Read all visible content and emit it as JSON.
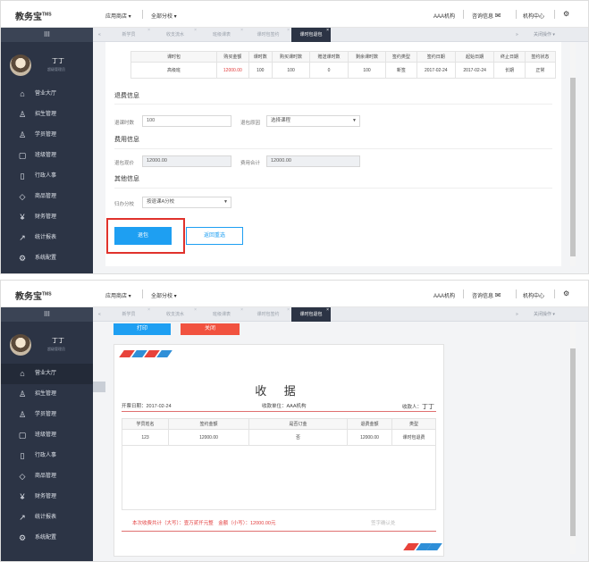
{
  "app": {
    "logo": "教务宝",
    "logo_sup": "TMS",
    "menu_app_store": "应用商店 ▾",
    "menu_campus": "全部分校 ▾",
    "org": "AAA机构",
    "consult": "咨询信息",
    "mail_icon": "✉",
    "org_center": "机构中心",
    "gear_icon": "⚙"
  },
  "sidebar": {
    "toggle": "III",
    "user_name": "丁丁",
    "user_role": "超级管理员",
    "items": [
      {
        "label": "营业大厅",
        "icon": "⌂"
      },
      {
        "label": "招生管理",
        "icon": "♙"
      },
      {
        "label": "学员管理",
        "icon": "♙"
      },
      {
        "label": "班级管理",
        "icon": "▢"
      },
      {
        "label": "行政人事",
        "icon": "▯"
      },
      {
        "label": "商品管理",
        "icon": "◇"
      },
      {
        "label": "财务管理",
        "icon": "¥"
      },
      {
        "label": "统计报表",
        "icon": "↗"
      },
      {
        "label": "系统配置",
        "icon": "⚙"
      }
    ]
  },
  "tabs": {
    "prev": "«",
    "items": [
      "新学员",
      "收支流水",
      "班级课表",
      "课时包签约",
      "课时包退包"
    ],
    "next": "»",
    "close_ops": "关闭操作 ▾"
  },
  "refund": {
    "table_headers": [
      "课时包",
      "购买金额",
      "课时数",
      "购买课时数",
      "赠送课时数",
      "剩余课时数",
      "签约类型",
      "签约日期",
      "起始日期",
      "终止日期",
      "签约状态"
    ],
    "table_row": [
      "高级班",
      "12000.00",
      "100",
      "100",
      "0",
      "100",
      "新签",
      "2017-02-24",
      "2017-02-24",
      "长期",
      "正常"
    ],
    "section_refund": "退费信息",
    "refund_hours_label": "退课时数",
    "refund_hours_value": "100",
    "refund_reason_label": "退包原因",
    "refund_reason_value": "选择课程",
    "section_fee": "费用信息",
    "refund_amount_label": "退包现价",
    "refund_amount_value": "12000.00",
    "fee_total_label": "费用合计",
    "fee_total_value": "12000.00",
    "section_other": "其他信息",
    "campus_label": "归办分校",
    "campus_value": "按退课A分校",
    "btn_refund": "退包",
    "btn_back": "返回重选"
  },
  "receipt": {
    "btn_print": "打印",
    "btn_close": "关闭",
    "title": "收 据",
    "date_label": "开票日期：2017-02-24",
    "org_label": "收款单位：AAA机构",
    "payee_label": "收款人：",
    "payee_value": "丁丁",
    "headers": [
      "学员姓名",
      "签约金额",
      "是否订金",
      "退费金额",
      "类型"
    ],
    "row": [
      "123",
      "12000.00",
      "否",
      "12000.00",
      "课时包退费"
    ],
    "total": "本次收费共计（大写）：壹万贰仟元整　金额（小写）：12000.00元",
    "sign": "签字确认处"
  }
}
